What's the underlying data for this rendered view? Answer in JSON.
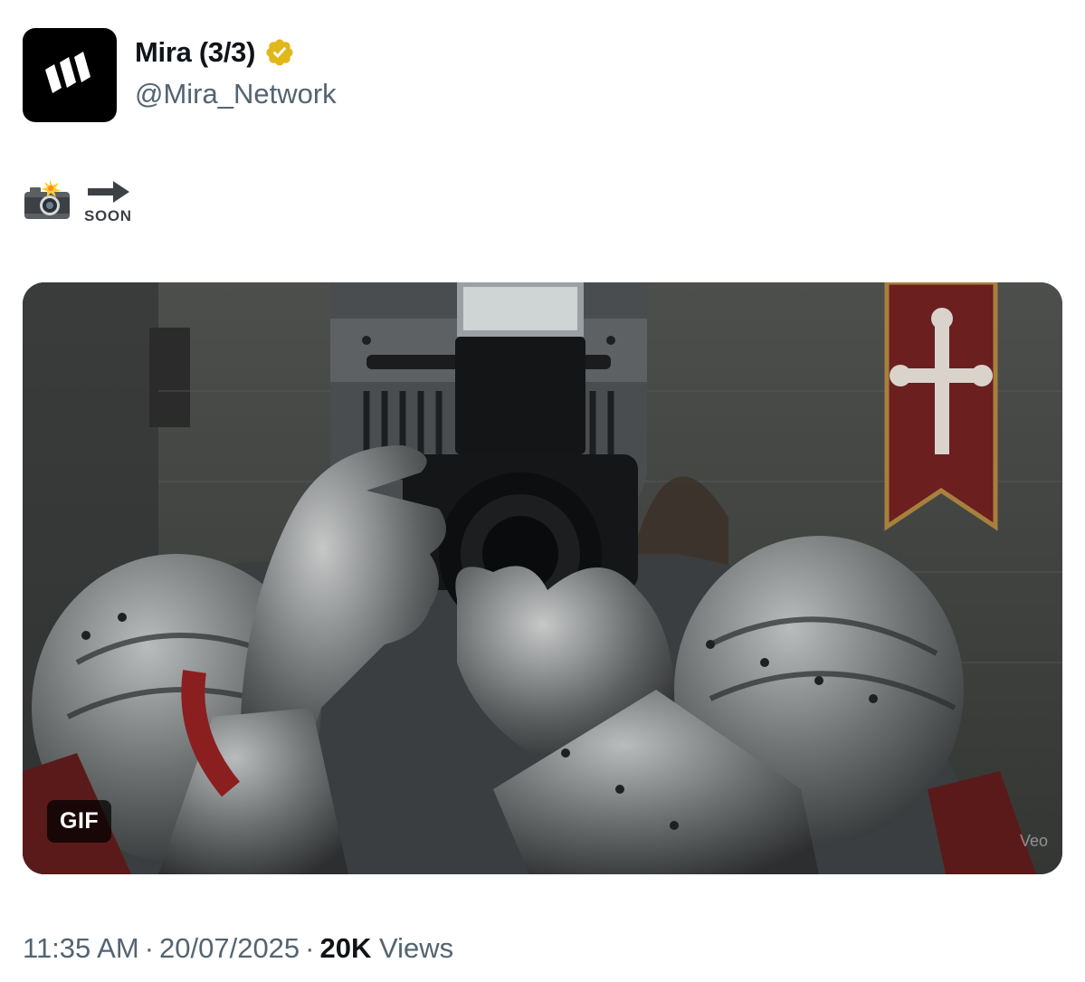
{
  "author": {
    "display_name": "Mira (3/3)",
    "handle": "@Mira_Network",
    "avatar_icon": "mira-logo-icon",
    "verified_icon": "verified-badge-icon",
    "verified_color": "#e2b719"
  },
  "tweet": {
    "emojis": [
      "camera-with-flash-emoji",
      "soon-arrow-emoji"
    ]
  },
  "media": {
    "badge": "GIF",
    "watermark": "Veo"
  },
  "meta": {
    "time": "11:35 AM",
    "date": "20/07/2025",
    "separator": "·",
    "views_count": "20K",
    "views_label": "Views"
  }
}
